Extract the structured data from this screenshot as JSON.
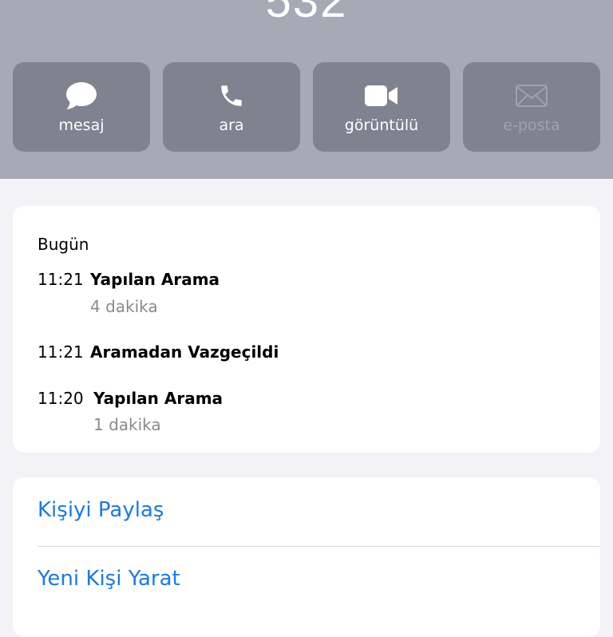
{
  "header": {
    "number": "532",
    "actions": [
      {
        "label": "mesaj",
        "icon": "message-bubble-icon",
        "enabled": true
      },
      {
        "label": "ara",
        "icon": "phone-icon",
        "enabled": true
      },
      {
        "label": "görüntülü",
        "icon": "video-camera-icon",
        "enabled": true
      },
      {
        "label": "e-posta",
        "icon": "envelope-icon",
        "enabled": false
      }
    ]
  },
  "history": {
    "section": "Bugün",
    "entries": [
      {
        "time": "11:21",
        "title": "Yapılan Arama",
        "detail": "4 dakika"
      },
      {
        "time": "11:21",
        "title": "Aramadan Vazgeçildi",
        "detail": ""
      },
      {
        "time": "11:20",
        "title": "Yapılan Arama",
        "detail": "1 dakika"
      }
    ]
  },
  "links": {
    "share": "Kişiyi Paylaş",
    "create": "Yeni Kişi Yarat"
  },
  "colors": {
    "header_bg": "#a7a9b5",
    "button_bg": "#7f828f",
    "link": "#1a7ae6",
    "page_bg": "#f2f2f7"
  }
}
